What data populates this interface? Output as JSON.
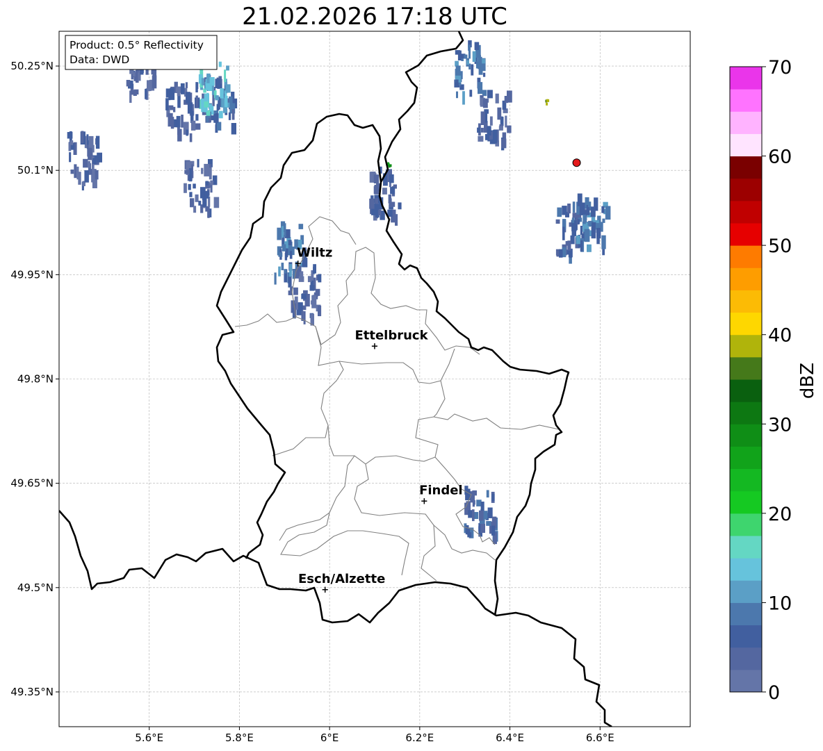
{
  "title": "21.02.2026 17:18 UTC",
  "info_box": {
    "line1": "Product: 0.5° Reflectivity",
    "line2": "Data: DWD"
  },
  "map": {
    "lon_range": [
      5.4,
      6.8
    ],
    "lat_range": [
      49.3,
      50.3
    ],
    "x_ticks": [
      {
        "value": 5.6,
        "label": "5.6°E"
      },
      {
        "value": 5.8,
        "label": "5.8°E"
      },
      {
        "value": 6.0,
        "label": "6°E"
      },
      {
        "value": 6.2,
        "label": "6.2°E"
      },
      {
        "value": 6.4,
        "label": "6.4°E"
      },
      {
        "value": 6.6,
        "label": "6.6°E"
      }
    ],
    "y_ticks": [
      {
        "value": 49.35,
        "label": "49.35°N"
      },
      {
        "value": 49.5,
        "label": "49.5°N"
      },
      {
        "value": 49.65,
        "label": "49.65°N"
      },
      {
        "value": 49.8,
        "label": "49.8°N"
      },
      {
        "value": 49.95,
        "label": "49.95°N"
      },
      {
        "value": 50.1,
        "label": "50.1°N"
      },
      {
        "value": 50.25,
        "label": "50.25°N"
      }
    ],
    "grid": true,
    "cities": [
      {
        "name": "Wiltz",
        "lon": 5.93,
        "lat": 49.966
      },
      {
        "name": "Ettelbruck",
        "lon": 6.1,
        "lat": 49.847
      },
      {
        "name": "Findel",
        "lon": 6.21,
        "lat": 49.624
      },
      {
        "name": "Esch/Alzette",
        "lon": 5.99,
        "lat": 49.497
      }
    ],
    "radar_site": {
      "lon": 6.548,
      "lat": 50.111,
      "color": "#e41a1c"
    }
  },
  "colorbar": {
    "label": "dBZ",
    "min": 0,
    "max": 70,
    "ticks": [
      {
        "value": 0,
        "label": "0"
      },
      {
        "value": 10,
        "label": "10"
      },
      {
        "value": 20,
        "label": "20"
      },
      {
        "value": 30,
        "label": "30"
      },
      {
        "value": 40,
        "label": "40"
      },
      {
        "value": 50,
        "label": "50"
      },
      {
        "value": 60,
        "label": "60"
      },
      {
        "value": 70,
        "label": "70"
      }
    ],
    "colors": [
      "#6475a8",
      "#5467a0",
      "#415f9f",
      "#4c78ad",
      "#5b9fc6",
      "#66c3dc",
      "#64d7c3",
      "#3ed56e",
      "#15c922",
      "#14b822",
      "#11a31a",
      "#0f8e16",
      "#0d7812",
      "#0a600f",
      "#45791a",
      "#b0b40b",
      "#fed700",
      "#fcbb05",
      "#fe9d00",
      "#fe7b00",
      "#e60000",
      "#c00000",
      "#9c0000",
      "#7a0000",
      "#ffe4ff",
      "#ffb3ff",
      "#ff73ff",
      "#ea35ea"
    ]
  },
  "radar_echoes": [
    {
      "lon": 5.75,
      "lat": 50.2,
      "dbz": 6
    },
    {
      "lon": 5.74,
      "lat": 50.22,
      "dbz": 14
    },
    {
      "lon": 5.67,
      "lat": 50.19,
      "dbz": 4
    },
    {
      "lon": 5.58,
      "lat": 50.25,
      "dbz": 4
    },
    {
      "lon": 5.45,
      "lat": 50.12,
      "dbz": 4
    },
    {
      "lon": 5.71,
      "lat": 50.08,
      "dbz": 4
    },
    {
      "lon": 5.91,
      "lat": 49.99,
      "dbz": 8
    },
    {
      "lon": 5.94,
      "lat": 49.93,
      "dbz": 4
    },
    {
      "lon": 6.31,
      "lat": 50.25,
      "dbz": 8
    },
    {
      "lon": 6.36,
      "lat": 50.18,
      "dbz": 4
    },
    {
      "lon": 6.53,
      "lat": 50.02,
      "dbz": 6
    },
    {
      "lon": 6.58,
      "lat": 50.03,
      "dbz": 8
    },
    {
      "lon": 6.12,
      "lat": 50.07,
      "dbz": 4
    },
    {
      "lon": 6.13,
      "lat": 50.11,
      "dbz": 28
    },
    {
      "lon": 6.33,
      "lat": 49.61,
      "dbz": 6
    },
    {
      "lon": 6.48,
      "lat": 50.2,
      "dbz": 38
    }
  ]
}
